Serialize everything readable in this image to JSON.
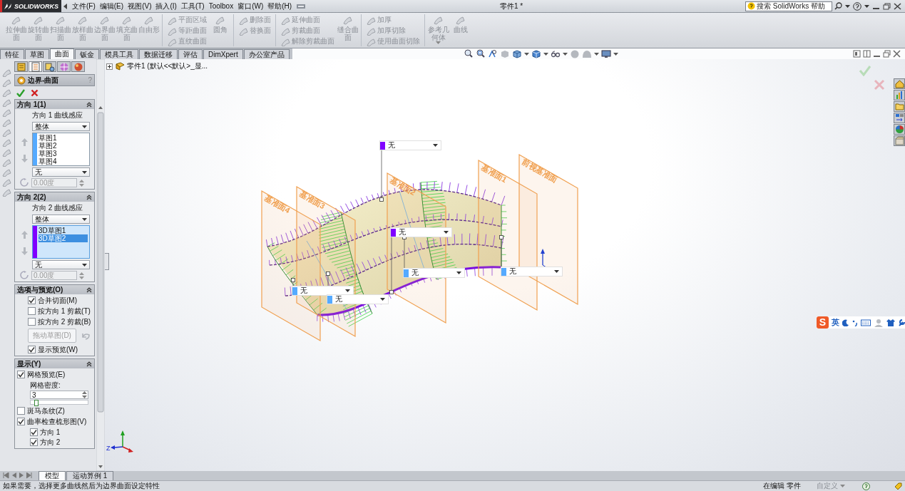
{
  "title_bar": {
    "logo": "SOLIDWORKS",
    "menu": [
      "文件(F)",
      "编辑(E)",
      "视图(V)",
      "插入(I)",
      "工具(T)",
      "Toolbox",
      "窗口(W)",
      "帮助(H)"
    ],
    "document_title": "零件1 *",
    "search": {
      "placeholder": "搜索 SolidWorks 帮助"
    }
  },
  "ribbon": [
    {
      "columns": [
        {
          "kind": "large",
          "items": [
            {
              "label": "拉伸曲面",
              "disabled": true
            },
            {
              "label": "旋转曲面",
              "disabled": true
            },
            {
              "label": "扫描曲面",
              "disabled": true
            },
            {
              "label": "放样曲面",
              "disabled": true
            },
            {
              "label": "边界曲面",
              "disabled": true
            },
            {
              "label": "填充曲面",
              "disabled": true
            },
            {
              "label": "自由形",
              "disabled": true
            }
          ]
        }
      ]
    },
    {
      "columns": [
        {
          "kind": "stack",
          "items": [
            {
              "label": "平面区域",
              "disabled": true
            },
            {
              "label": "等距曲面",
              "disabled": true
            },
            {
              "label": "直纹曲面",
              "disabled": true
            }
          ]
        },
        {
          "kind": "large",
          "items": [
            {
              "label": "圆角",
              "disabled": true
            }
          ]
        }
      ]
    },
    {
      "columns": [
        {
          "kind": "stack",
          "items": [
            {
              "label": "删除面",
              "disabled": true
            },
            {
              "label": "替换面",
              "disabled": true
            }
          ]
        }
      ]
    },
    {
      "columns": [
        {
          "kind": "stack",
          "items": [
            {
              "label": "延伸曲面",
              "disabled": true
            },
            {
              "label": "剪裁曲面",
              "disabled": true
            },
            {
              "label": "解除剪裁曲面",
              "disabled": true
            }
          ]
        },
        {
          "kind": "large",
          "items": [
            {
              "label": "缝合曲面",
              "disabled": true
            }
          ]
        }
      ]
    },
    {
      "columns": [
        {
          "kind": "stack",
          "items": [
            {
              "label": "加厚",
              "disabled": true
            },
            {
              "label": "加厚切除",
              "disabled": true
            },
            {
              "label": "使用曲面切除",
              "disabled": true
            }
          ]
        }
      ]
    },
    {
      "columns": [
        {
          "kind": "large",
          "items": [
            {
              "label": "参考几何体",
              "disabled": true,
              "menu": true
            },
            {
              "label": "曲线",
              "disabled": true
            }
          ]
        }
      ]
    }
  ],
  "command_tabs": [
    {
      "label": "特征",
      "selected": false
    },
    {
      "label": "草图",
      "selected": false
    },
    {
      "label": "曲面",
      "selected": true
    },
    {
      "label": "钣金",
      "selected": false
    },
    {
      "label": "模具工具",
      "selected": false
    },
    {
      "label": "数据迁移",
      "selected": false
    },
    {
      "label": "评估",
      "selected": false
    },
    {
      "label": "DimXpert",
      "selected": false
    },
    {
      "label": "办公室产品",
      "selected": false
    }
  ],
  "property_manager": {
    "tabs": [
      {
        "selected": false
      },
      {
        "selected": true
      },
      {
        "selected": false
      },
      {
        "selected": false
      },
      {
        "selected": false
      }
    ],
    "title": "边界-曲面",
    "help": "?",
    "groups": [
      {
        "kind": "direction",
        "title": "方向 1(1)",
        "expanded": true,
        "label": "方向 1 曲线感应",
        "mode": "整体",
        "active": false,
        "color": "#55aaff",
        "curves": [
          {
            "name": "草图1",
            "selected": false
          },
          {
            "name": "草图2",
            "selected": false
          },
          {
            "name": "草图3",
            "selected": false
          },
          {
            "name": "草图4",
            "selected": false
          }
        ],
        "tangency": "无",
        "angle": {
          "value": "0.00度",
          "disabled": true
        }
      },
      {
        "kind": "direction",
        "title": "方向 2(2)",
        "expanded": true,
        "label": "方向 2 曲线感应",
        "mode": "整体",
        "active": true,
        "color": "#8000ff",
        "curves": [
          {
            "name": "3D草图1",
            "selected": false
          },
          {
            "name": "3D草图2",
            "selected": true
          }
        ],
        "tangency": "无",
        "angle": {
          "value": "0.00度",
          "disabled": true
        }
      },
      {
        "kind": "options",
        "title": "选项与预览(O)",
        "expanded": true,
        "rows": [
          {
            "kind": "checkbox",
            "label": "合并切面(M)",
            "checked": true
          },
          {
            "kind": "checkbox",
            "label": "按方向 1 剪裁(T)",
            "checked": false
          },
          {
            "kind": "checkbox",
            "label": "按方向 2 剪裁(B)",
            "checked": false
          },
          {
            "kind": "button",
            "label": "拖动草图(D)",
            "disabled": true
          },
          {
            "kind": "checkbox",
            "label": "显示预览(W)",
            "checked": true
          }
        ]
      },
      {
        "kind": "display",
        "title": "显示(Y)",
        "expanded": true,
        "rows": [
          {
            "kind": "checkbox",
            "label": "网格预览(E)",
            "checked": true,
            "children": [
              {
                "kind": "label",
                "label": "网格密度:"
              },
              {
                "kind": "spinner",
                "value": "3",
                "level": 0.1
              }
            ]
          },
          {
            "kind": "checkbox",
            "label": "斑马条纹(Z)",
            "checked": false
          },
          {
            "kind": "checkbox",
            "label": "曲率检查梳形图(V)",
            "checked": true,
            "children": [
              {
                "kind": "checkbox",
                "label": "方向 1",
                "checked": true
              },
              {
                "kind": "checkbox",
                "label": "方向 2",
                "checked": true
              }
            ]
          }
        ]
      }
    ]
  },
  "viewport": {
    "tree_root": "零件1  (默认<<默认>_显...",
    "planes": [
      {
        "label": "基准面4"
      },
      {
        "label": "基准面3"
      },
      {
        "label": "基准面2"
      },
      {
        "label": "基准面1"
      },
      {
        "label": "前视基准面"
      }
    ],
    "callouts": [
      {
        "value": "无",
        "color": "#8000ff"
      },
      {
        "value": "无",
        "color": "#8000ff"
      },
      {
        "value": "无",
        "color": "#55aaff"
      },
      {
        "value": "无",
        "color": "#55aaff"
      },
      {
        "value": "无",
        "color": "#55aaff"
      },
      {
        "value": "无",
        "color": "#55aaff"
      }
    ],
    "axis_label": "Z"
  },
  "ime_bar": {
    "logo": "S",
    "mode": "英"
  },
  "bottom_tabs": [
    {
      "label": "模型",
      "selected": true
    },
    {
      "label": "运动算例 1",
      "selected": false
    }
  ],
  "status_bar": {
    "message": "如果需要，选择更多曲线然后为边界曲面设定特性",
    "mode": "在编辑 零件",
    "units": "自定义"
  }
}
